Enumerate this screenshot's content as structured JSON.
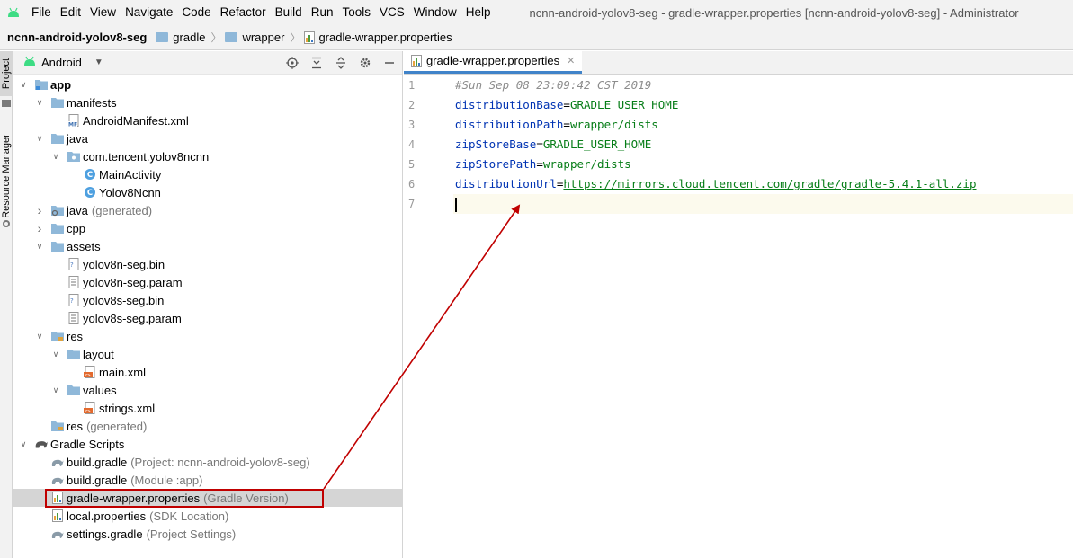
{
  "window": {
    "title": "ncnn-android-yolov8-seg - gradle-wrapper.properties [ncnn-android-yolov8-seg] - Administrator"
  },
  "menu": [
    "File",
    "Edit",
    "View",
    "Navigate",
    "Code",
    "Refactor",
    "Build",
    "Run",
    "Tools",
    "VCS",
    "Window",
    "Help"
  ],
  "breadcrumb": [
    "ncnn-android-yolov8-seg",
    "gradle",
    "wrapper",
    "gradle-wrapper.properties"
  ],
  "side_tabs": {
    "project": "Project",
    "resource_manager": "Resource Manager"
  },
  "project_panel": {
    "view_mode": "Android"
  },
  "tree": [
    {
      "label": "app",
      "hint": "",
      "depth": 0,
      "expanded": "open",
      "icon": "module-folder-icon",
      "bold": true
    },
    {
      "label": "manifests",
      "hint": "",
      "depth": 1,
      "expanded": "open",
      "icon": "folder-icon"
    },
    {
      "label": "AndroidManifest.xml",
      "hint": "",
      "depth": 2,
      "expanded": "none",
      "icon": "manifest-file-icon"
    },
    {
      "label": "java",
      "hint": "",
      "depth": 1,
      "expanded": "open",
      "icon": "folder-icon"
    },
    {
      "label": "com.tencent.yolov8ncnn",
      "hint": "",
      "depth": 2,
      "expanded": "open",
      "icon": "package-icon"
    },
    {
      "label": "MainActivity",
      "hint": "",
      "depth": 3,
      "expanded": "none",
      "icon": "class-icon"
    },
    {
      "label": "Yolov8Ncnn",
      "hint": "",
      "depth": 3,
      "expanded": "none",
      "icon": "class-icon"
    },
    {
      "label": "java",
      "hint": "(generated)",
      "depth": 1,
      "expanded": "closed",
      "icon": "generated-folder-icon"
    },
    {
      "label": "cpp",
      "hint": "",
      "depth": 1,
      "expanded": "closed",
      "icon": "folder-icon"
    },
    {
      "label": "assets",
      "hint": "",
      "depth": 1,
      "expanded": "open",
      "icon": "folder-icon"
    },
    {
      "label": "yolov8n-seg.bin",
      "hint": "",
      "depth": 2,
      "expanded": "none",
      "icon": "binary-file-icon"
    },
    {
      "label": "yolov8n-seg.param",
      "hint": "",
      "depth": 2,
      "expanded": "none",
      "icon": "text-file-icon"
    },
    {
      "label": "yolov8s-seg.bin",
      "hint": "",
      "depth": 2,
      "expanded": "none",
      "icon": "binary-file-icon"
    },
    {
      "label": "yolov8s-seg.param",
      "hint": "",
      "depth": 2,
      "expanded": "none",
      "icon": "text-file-icon"
    },
    {
      "label": "res",
      "hint": "",
      "depth": 1,
      "expanded": "open",
      "icon": "res-folder-icon"
    },
    {
      "label": "layout",
      "hint": "",
      "depth": 2,
      "expanded": "open",
      "icon": "folder-icon"
    },
    {
      "label": "main.xml",
      "hint": "",
      "depth": 3,
      "expanded": "none",
      "icon": "xml-file-icon"
    },
    {
      "label": "values",
      "hint": "",
      "depth": 2,
      "expanded": "open",
      "icon": "folder-icon"
    },
    {
      "label": "strings.xml",
      "hint": "",
      "depth": 3,
      "expanded": "none",
      "icon": "xml-file-icon"
    },
    {
      "label": "res",
      "hint": "(generated)",
      "depth": 1,
      "expanded": "none",
      "icon": "res-folder-icon"
    },
    {
      "label": "Gradle Scripts",
      "hint": "",
      "depth": 0,
      "expanded": "open",
      "icon": "gradle-elephant-icon"
    },
    {
      "label": "build.gradle",
      "hint": "(Project: ncnn-android-yolov8-seg)",
      "depth": 1,
      "expanded": "none",
      "icon": "gradle-file-icon"
    },
    {
      "label": "build.gradle",
      "hint": "(Module :app)",
      "depth": 1,
      "expanded": "none",
      "icon": "gradle-file-icon"
    },
    {
      "label": "gradle-wrapper.properties",
      "hint": "(Gradle Version)",
      "depth": 1,
      "expanded": "none",
      "icon": "properties-file-icon",
      "selected": true
    },
    {
      "label": "local.properties",
      "hint": "(SDK Location)",
      "depth": 1,
      "expanded": "none",
      "icon": "properties-file-icon"
    },
    {
      "label": "settings.gradle",
      "hint": "(Project Settings)",
      "depth": 1,
      "expanded": "none",
      "icon": "gradle-file-icon"
    }
  ],
  "editor": {
    "tab_label": "gradle-wrapper.properties",
    "lines": [
      {
        "n": "1",
        "comment": "#Sun Sep 08 23:09:42 CST 2019"
      },
      {
        "n": "2",
        "key": "distributionBase",
        "value": "GRADLE_USER_HOME"
      },
      {
        "n": "3",
        "key": "distributionPath",
        "value": "wrapper/dists"
      },
      {
        "n": "4",
        "key": "zipStoreBase",
        "value": "GRADLE_USER_HOME"
      },
      {
        "n": "5",
        "key": "zipStorePath",
        "value": "wrapper/dists"
      },
      {
        "n": "6",
        "key": "distributionUrl",
        "url": "https://mirrors.cloud.tencent.com/gradle/gradle-5.4.1-all.zip"
      },
      {
        "n": "7",
        "current": true
      }
    ]
  },
  "colors": {
    "annotation": "#c00000",
    "selection": "#d5d5d5",
    "key": "#0033b3",
    "value": "#067d17"
  }
}
